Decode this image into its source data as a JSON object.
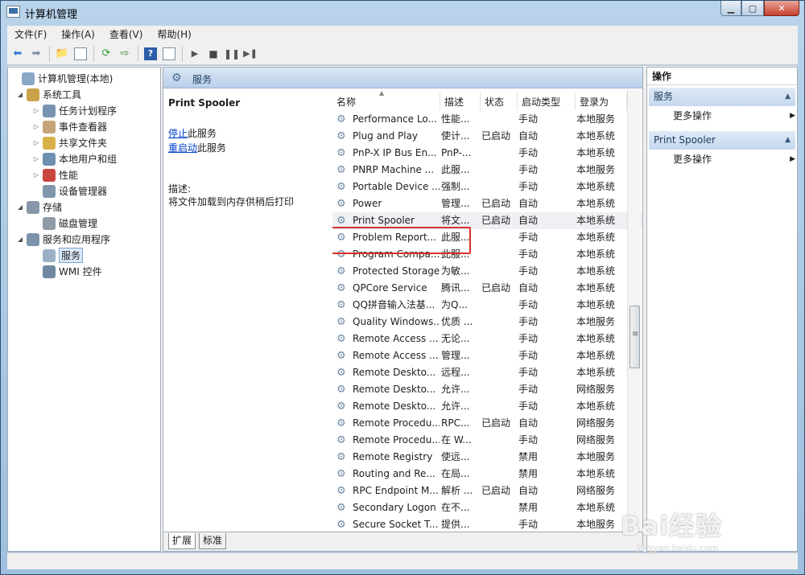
{
  "window": {
    "title": "计算机管理"
  },
  "menu": [
    "文件(F)",
    "操作(A)",
    "查看(V)",
    "帮助(H)"
  ],
  "tree": [
    {
      "label": "计算机管理(本地)",
      "depth": 0,
      "arrow": "",
      "icon": "computer-icon"
    },
    {
      "label": "系统工具",
      "depth": 1,
      "arrow": "◢",
      "icon": "tools-icon"
    },
    {
      "label": "任务计划程序",
      "depth": 2,
      "arrow": "▷",
      "icon": "clock-icon"
    },
    {
      "label": "事件查看器",
      "depth": 2,
      "arrow": "▷",
      "icon": "event-viewer-icon"
    },
    {
      "label": "共享文件夹",
      "depth": 2,
      "arrow": "▷",
      "icon": "shared-folder-icon"
    },
    {
      "label": "本地用户和组",
      "depth": 2,
      "arrow": "▷",
      "icon": "users-icon"
    },
    {
      "label": "性能",
      "depth": 2,
      "arrow": "▷",
      "icon": "performance-icon"
    },
    {
      "label": "设备管理器",
      "depth": 2,
      "arrow": "",
      "icon": "device-manager-icon"
    },
    {
      "label": "存储",
      "depth": 1,
      "arrow": "◢",
      "icon": "storage-icon"
    },
    {
      "label": "磁盘管理",
      "depth": 2,
      "arrow": "",
      "icon": "disk-icon"
    },
    {
      "label": "服务和应用程序",
      "depth": 1,
      "arrow": "◢",
      "icon": "services-apps-icon"
    },
    {
      "label": "服务",
      "depth": 2,
      "arrow": "",
      "icon": "gear-icon",
      "selected": true
    },
    {
      "label": "WMI 控件",
      "depth": 2,
      "arrow": "",
      "icon": "wmi-icon"
    }
  ],
  "middle": {
    "header": "服务",
    "selected_title": "Print Spooler",
    "stop_link": "停止",
    "stop_suffix": "此服务",
    "restart_link": "重启动",
    "restart_suffix": "此服务",
    "desc_label": "描述:",
    "desc_text": "将文件加载到内存供稍后打印"
  },
  "columns": [
    "名称",
    "描述",
    "状态",
    "启动类型",
    "登录为"
  ],
  "rows": [
    [
      "Performance Lo...",
      "性能...",
      "",
      "手动",
      "本地服务"
    ],
    [
      "Plug and Play",
      "使计...",
      "已启动",
      "自动",
      "本地系统"
    ],
    [
      "PnP-X IP Bus En...",
      "PnP-...",
      "",
      "手动",
      "本地系统"
    ],
    [
      "PNRP Machine ...",
      "此服...",
      "",
      "手动",
      "本地服务"
    ],
    [
      "Portable Device ...",
      "强制...",
      "",
      "手动",
      "本地系统"
    ],
    [
      "Power",
      "管理...",
      "已启动",
      "自动",
      "本地系统"
    ],
    [
      "Print Spooler",
      "将文...",
      "已启动",
      "自动",
      "本地系统"
    ],
    [
      "Problem Report...",
      "此服...",
      "",
      "手动",
      "本地系统"
    ],
    [
      "Program Compa...",
      "此服...",
      "",
      "手动",
      "本地系统"
    ],
    [
      "Protected Storage",
      "为敏...",
      "",
      "手动",
      "本地系统"
    ],
    [
      "QPCore Service",
      "腾讯...",
      "已启动",
      "自动",
      "本地系统"
    ],
    [
      "QQ拼音输入法基...",
      "为Q...",
      "",
      "手动",
      "本地系统"
    ],
    [
      "Quality Windows...",
      "优质 ...",
      "",
      "手动",
      "本地服务"
    ],
    [
      "Remote Access ...",
      "无论...",
      "",
      "手动",
      "本地系统"
    ],
    [
      "Remote Access ...",
      "管理...",
      "",
      "手动",
      "本地系统"
    ],
    [
      "Remote Deskto...",
      "远程...",
      "",
      "手动",
      "本地系统"
    ],
    [
      "Remote Deskto...",
      "允许...",
      "",
      "手动",
      "网络服务"
    ],
    [
      "Remote Deskto...",
      "允许...",
      "",
      "手动",
      "本地系统"
    ],
    [
      "Remote Procedu...",
      "RPC...",
      "已启动",
      "自动",
      "网络服务"
    ],
    [
      "Remote Procedu...",
      "在 W...",
      "",
      "手动",
      "网络服务"
    ],
    [
      "Remote Registry",
      "使远...",
      "",
      "禁用",
      "本地服务"
    ],
    [
      "Routing and Re...",
      "在局...",
      "",
      "禁用",
      "本地系统"
    ],
    [
      "RPC Endpoint M...",
      "解析 ...",
      "已启动",
      "自动",
      "网络服务"
    ],
    [
      "Secondary Logon",
      "在不...",
      "",
      "禁用",
      "本地系统"
    ],
    [
      "Secure Socket T...",
      "提供...",
      "",
      "手动",
      "本地服务"
    ]
  ],
  "highlight_row": 6,
  "tabs": [
    "扩展",
    "标准"
  ],
  "actions": {
    "header": "操作",
    "sections": [
      {
        "title": "服务",
        "item": "更多操作"
      },
      {
        "title": "Print Spooler",
        "item": "更多操作"
      }
    ]
  },
  "watermark": {
    "brand": "Bai经验",
    "url": "jingyan.baidu.com"
  },
  "colors": {
    "title_bar": "#b9d3ea",
    "selection_box": "#d9302b",
    "link": "#0044cc"
  }
}
